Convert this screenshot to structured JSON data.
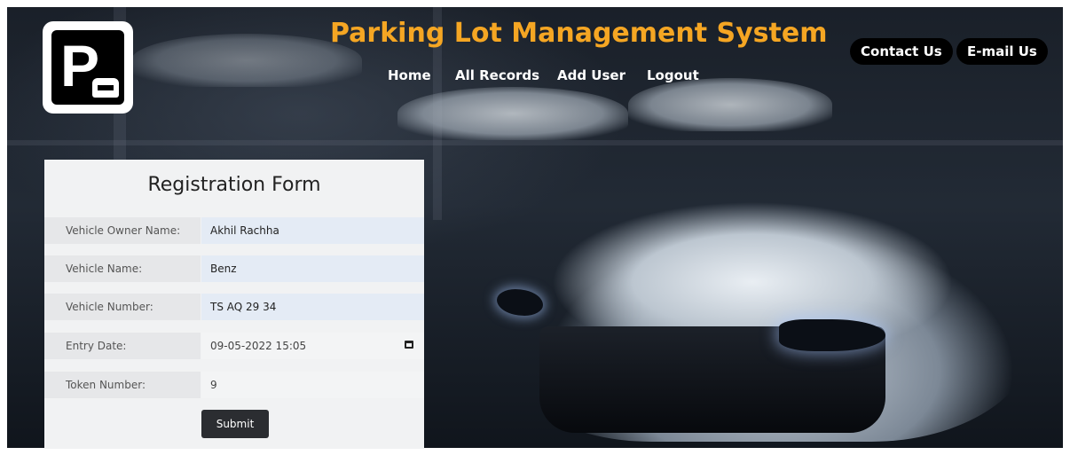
{
  "header": {
    "title": "Parking Lot Management System",
    "logo_letter": "P",
    "nav": [
      {
        "label": "Home"
      },
      {
        "label": "All Records"
      },
      {
        "label": "Add User"
      },
      {
        "label": "Logout"
      }
    ],
    "actions": [
      {
        "label": "Contact Us"
      },
      {
        "label": "E-mail Us"
      }
    ]
  },
  "form": {
    "title": "Registration Form",
    "fields": [
      {
        "label": "Vehicle Owner Name:",
        "value": "Akhil Rachha"
      },
      {
        "label": "Vehicle Name:",
        "value": "Benz"
      },
      {
        "label": "Vehicle Number:",
        "value": "TS AQ 29 34"
      },
      {
        "label": "Entry Date:",
        "value": "09-05-2022 15:05",
        "icon": "calendar-icon"
      },
      {
        "label": "Token Number:",
        "value": "9"
      }
    ],
    "submit_label": "Submit"
  },
  "colors": {
    "title": "#f5a623",
    "pill_bg": "#000000",
    "submit_bg": "#2b2d31",
    "autofill_bg": "#e4ebf5"
  }
}
